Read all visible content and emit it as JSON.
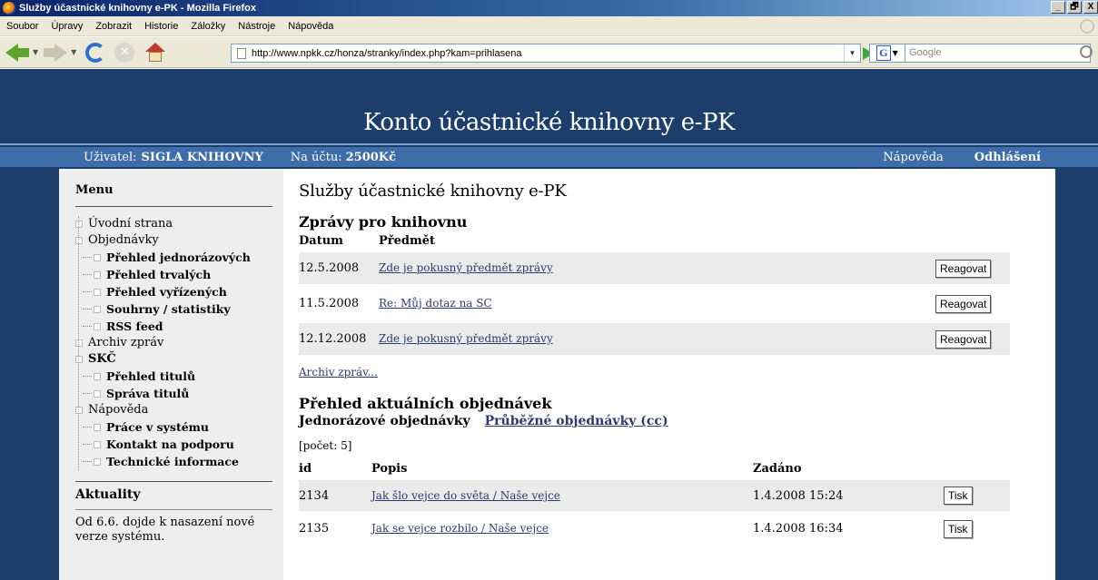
{
  "window": {
    "title": "Služby účastnické knihovny e-PK - Mozilla Firefox",
    "controls": [
      "_",
      "🗗",
      "X"
    ]
  },
  "menu": [
    "Soubor",
    "Úpravy",
    "Zobrazit",
    "Historie",
    "Záložky",
    "Nástroje",
    "Nápověda"
  ],
  "toolbar": {
    "url": "http://www.npkk.cz/honza/stranky/index.php?kam=prihlasena",
    "search_placeholder": "Google",
    "search_engine": "G"
  },
  "header": {
    "title": "Konto účastnické knihovny e-PK",
    "user_label": "Uživatel:",
    "user_name": "SIGLA KNIHOVNY",
    "account_label": "Na účtu:",
    "account_value": "2500Kč",
    "help": "Nápověda",
    "logout": "Odhlášení"
  },
  "sidebar": {
    "menu_title": "Menu",
    "items": [
      {
        "label": "Úvodní strana",
        "level": 0
      },
      {
        "label": "Objednávky",
        "level": 0
      },
      {
        "label": "Přehled jednorázových",
        "level": 1
      },
      {
        "label": "Přehled trvalých",
        "level": 1
      },
      {
        "label": "Přehled vyřízených",
        "level": 1
      },
      {
        "label": "Souhrny / statistiky",
        "level": 1
      },
      {
        "label": "RSS feed",
        "level": 1
      },
      {
        "label": "Archiv zpráv",
        "level": 0
      },
      {
        "label": "SKČ",
        "level": 0
      },
      {
        "label": "Přehled titulů",
        "level": 1
      },
      {
        "label": "Správa titulů",
        "level": 1
      },
      {
        "label": "Nápověda",
        "level": 0
      },
      {
        "label": "Práce v systému",
        "level": 1
      },
      {
        "label": "Kontakt na podporu",
        "level": 1
      },
      {
        "label": "Technické informace",
        "level": 1
      }
    ],
    "news_title": "Aktuality",
    "news_text": "Od 6.6. dojde k nasazení nové verze systému."
  },
  "main": {
    "page_title": "Služby účastnické knihovny e-PK",
    "messages": {
      "title": "Zprávy pro knihovnu",
      "col_date": "Datum",
      "col_subject": "Předmět",
      "rows": [
        {
          "date": "12.5.2008",
          "subject": "Zde je pokusný předmět zprávy",
          "action": "Reagovat"
        },
        {
          "date": "11.5.2008",
          "subject": "Re: Můj dotaz na SC",
          "action": "Reagovat"
        },
        {
          "date": "12.12.2008",
          "subject": "Zde je pokusný předmět zprávy",
          "action": "Reagovat"
        }
      ],
      "archive_link": "Archiv zpráv..."
    },
    "orders": {
      "title": "Přehled aktuálních objednávek",
      "tab_single": "Jednorázové objednávky",
      "tab_continuous": "Průběžné objednávky (cc)",
      "count": "[počet: 5]",
      "col_id": "id",
      "col_desc": "Popis",
      "col_date": "Zadáno",
      "rows": [
        {
          "id": "2134",
          "desc": "Jak šlo vejce do světa / Naše vejce",
          "date": "1.4.2008 15:24",
          "action": "Tisk"
        },
        {
          "id": "2135",
          "desc": "Jak se vejce rozbilo / Naše vejce",
          "date": "1.4.2008 16:34",
          "action": "Tisk"
        }
      ]
    }
  }
}
